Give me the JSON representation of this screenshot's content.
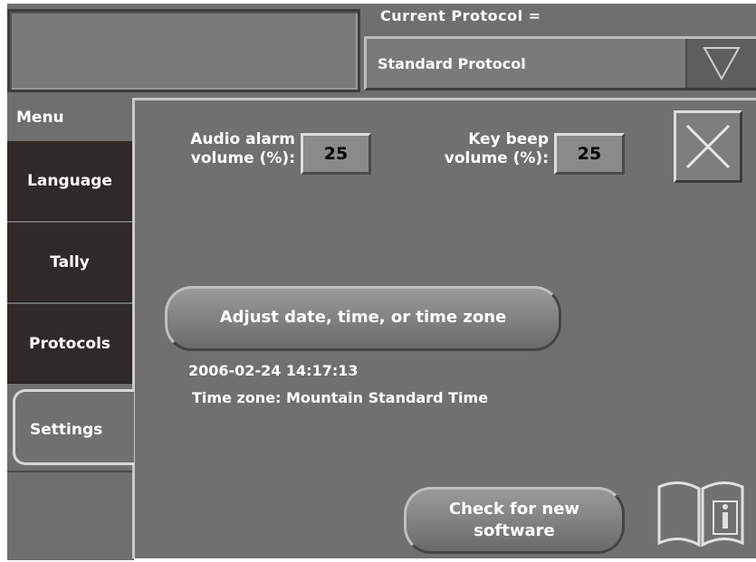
{
  "header": {
    "protocol_label": "Current Protocol =",
    "protocol_value": "Standard Protocol"
  },
  "menu": {
    "title": "Menu",
    "tabs": [
      {
        "label": "Language"
      },
      {
        "label": "Tally"
      },
      {
        "label": "Protocols"
      },
      {
        "label": "Settings",
        "selected": true
      }
    ]
  },
  "settings": {
    "audio_alarm_label_1": "Audio alarm",
    "audio_alarm_label_2": "volume (%):",
    "audio_alarm_value": "25",
    "key_beep_label_1": "Key beep",
    "key_beep_label_2": "volume (%):",
    "key_beep_value": "25",
    "adjust_button": "Adjust date, time, or time zone",
    "datetime": "2006-02-24  14:17:13",
    "timezone": "Time zone: Mountain Standard Time",
    "check_software_1": "Check for new",
    "check_software_2": "software"
  },
  "icons": {
    "close": "close-icon",
    "dropdown": "triangle-down-icon",
    "help": "book-info-icon"
  },
  "colors": {
    "panel": "#707070",
    "tab_dark": "#2f2a28",
    "text": "#ffffff"
  }
}
